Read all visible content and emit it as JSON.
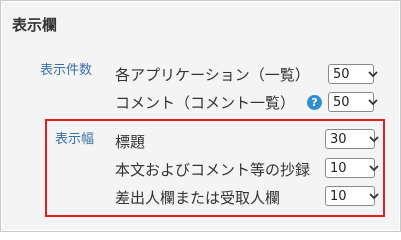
{
  "section": {
    "title": "表示欄"
  },
  "display_count": {
    "label": "表示件数",
    "rows": [
      {
        "label": "各アプリケーション（一覧）",
        "value": "50"
      },
      {
        "label": "コメント（コメント一覧）",
        "value": "50",
        "help_icon": "question-icon"
      }
    ]
  },
  "display_width": {
    "label": "表示幅",
    "rows": [
      {
        "label": "標題",
        "value": "30"
      },
      {
        "label": "本文およびコメント等の抄録",
        "value": "10"
      },
      {
        "label": "差出人欄または受取人欄",
        "value": "10"
      }
    ]
  },
  "colors": {
    "highlight": "#e02020",
    "group_label": "#3b6fa8",
    "help_icon": "#2f8fd0"
  }
}
